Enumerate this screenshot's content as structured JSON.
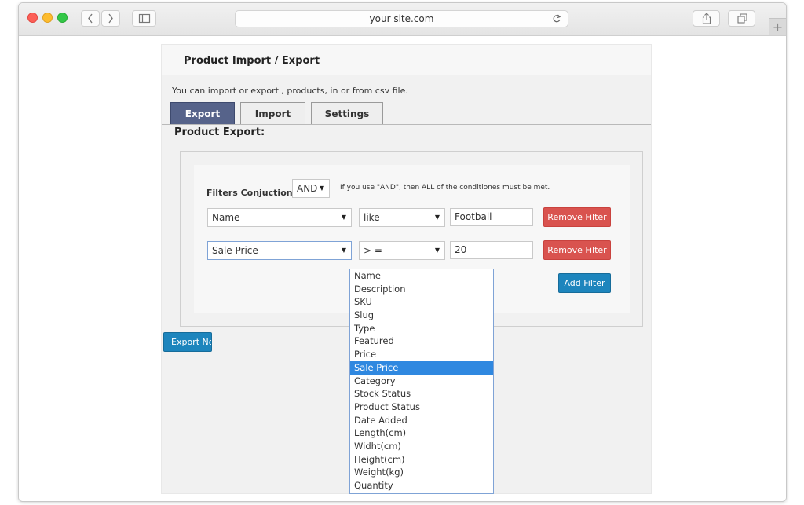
{
  "browser": {
    "url": "your site.com",
    "new_tab_label": "+"
  },
  "page": {
    "title": "Product Import / Export",
    "description": "You can import or export , products, in or from csv file.",
    "tabs": [
      {
        "label": "Export",
        "active": true
      },
      {
        "label": "Import",
        "active": false
      },
      {
        "label": "Settings",
        "active": false
      }
    ],
    "section_title": "Product Export:"
  },
  "filters": {
    "conjunction_label": "Filters Conjuction:",
    "conjunction_value": "AND",
    "hint": "If you use \"AND\", then ALL of the conditiones must be met.",
    "rows": [
      {
        "field": "Name",
        "operator": "like",
        "value": "Football",
        "remove_label": "Remove Filter"
      },
      {
        "field": "Sale Price",
        "operator": "> =",
        "value": "20",
        "remove_label": "Remove Filter"
      }
    ],
    "add_label": "Add Filter"
  },
  "export_button_label": "Export No",
  "dropdown": {
    "options": [
      "Name",
      "Description",
      "SKU",
      "Slug",
      "Type",
      "Featured",
      "Price",
      "Sale Price",
      "Category",
      "Stock Status",
      "Product Status",
      "Date Added",
      "Length(cm)",
      "Widht(cm)",
      "Height(cm)",
      "Weight(kg)",
      "Quantity"
    ],
    "highlighted": "Sale Price"
  },
  "colors": {
    "active_tab": "#56638a",
    "remove_button": "#d9534f",
    "primary_button": "#1d85bd",
    "highlight": "#2f88e0"
  }
}
